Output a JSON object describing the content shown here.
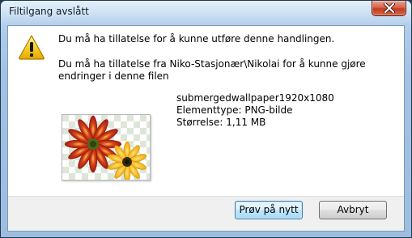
{
  "window": {
    "title": "Filtilgang avslått"
  },
  "dialog": {
    "main_instruction": "Du må ha tillatelse for å kunne utføre denne handlingen.",
    "content": "Du må ha tillatelse fra Niko-Stasjonær\\Nikolai for å kunne gjøre endringer i denne filen",
    "file": {
      "name": "submergedwallpaper1920x1080",
      "type": "Elementtype: PNG-bilde",
      "size": "Størrelse: 1,11 MB"
    }
  },
  "buttons": {
    "retry_label": "Prøv på nytt",
    "cancel_label": "Avbryt"
  },
  "icons": {
    "warning": "warning-icon",
    "close": "close-icon",
    "thumbnail": "png-image-thumbnail"
  }
}
